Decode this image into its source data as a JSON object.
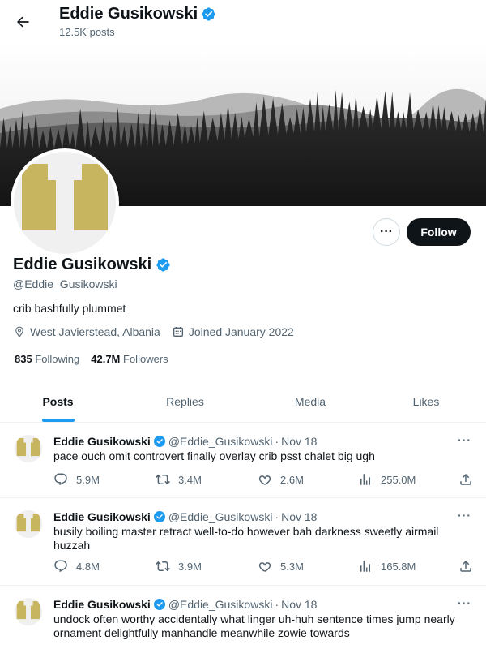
{
  "header": {
    "name": "Eddie Gusikowski",
    "posts_count": "12.5K posts"
  },
  "profile": {
    "name": "Eddie Gusikowski",
    "handle": "@Eddie_Gusikowski",
    "bio": "crib bashfully plummet",
    "location": "West Javierstead, Albania",
    "joined": "Joined January 2022",
    "following_count": "835",
    "following_label": "Following",
    "followers_count": "42.7M",
    "followers_label": "Followers",
    "follow_label": "Follow",
    "more_label": "···"
  },
  "tabs": [
    {
      "label": "Posts",
      "active": true
    },
    {
      "label": "Replies",
      "active": false
    },
    {
      "label": "Media",
      "active": false
    },
    {
      "label": "Likes",
      "active": false
    }
  ],
  "posts": [
    {
      "author": "Eddie Gusikowski",
      "handle": "@Eddie_Gusikowski",
      "dot": "·",
      "date": "Nov 18",
      "text": "pace ouch omit controvert finally overlay crib psst chalet big ugh",
      "replies": "5.9M",
      "reposts": "3.4M",
      "likes": "2.6M",
      "views": "255.0M"
    },
    {
      "author": "Eddie Gusikowski",
      "handle": "@Eddie_Gusikowski",
      "dot": "·",
      "date": "Nov 18",
      "text": "busily boiling master retract well-to-do however bah darkness sweetly airmail huzzah",
      "replies": "4.8M",
      "reposts": "3.9M",
      "likes": "5.3M",
      "views": "165.8M"
    },
    {
      "author": "Eddie Gusikowski",
      "handle": "@Eddie_Gusikowski",
      "dot": "·",
      "date": "Nov 18",
      "text": "undock often worthy accidentally what linger uh-huh sentence times jump nearly ornament delightfully manhandle meanwhile zowie towards",
      "replies": "",
      "reposts": "",
      "likes": "",
      "views": ""
    }
  ],
  "colors": {
    "accent": "#1d9bf0",
    "verified": "#1d9bf0",
    "avatar_art": "#c8b560",
    "text_primary": "#0f1419",
    "text_secondary": "#536471"
  },
  "icons": {
    "back": "arrow-left-icon",
    "verified": "verified-badge-icon",
    "location": "location-pin-icon",
    "calendar": "calendar-icon",
    "reply": "reply-icon",
    "repost": "repost-icon",
    "like": "heart-icon",
    "views": "views-chart-icon",
    "share": "share-icon"
  }
}
